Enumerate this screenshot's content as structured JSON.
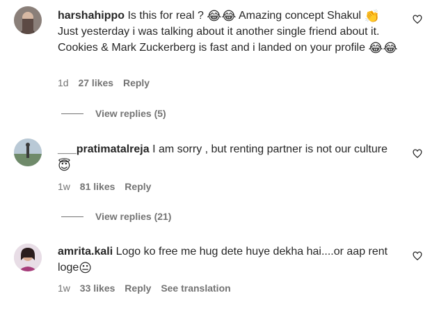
{
  "comments": [
    {
      "username": "harshahippo",
      "text_parts": [
        "Is this for real ? ",
        " Amazing concept Shakul ",
        " Just yesterday i was talking about it another single friend about it. Cookies & Mark Zuckerberg is fast and i landed on your profile "
      ],
      "emoji": [
        "😂😂",
        "👏",
        "😂😂"
      ],
      "time": "1d",
      "likes": "27 likes",
      "reply": "Reply",
      "view_replies": "View replies (5)"
    },
    {
      "username": "___pratimatalreja",
      "text_parts": [
        "I am sorry , but renting partner is not our culture "
      ],
      "emoji": [
        "😇"
      ],
      "time": "1w",
      "likes": "81 likes",
      "reply": "Reply",
      "view_replies": "View replies (21)"
    },
    {
      "username": "amrita.kali",
      "text_parts": [
        "Logo ko free me hug dete huye dekha hai....or aap rent loge"
      ],
      "emoji": [
        "😐"
      ],
      "time": "1w",
      "likes": "33 likes",
      "reply": "Reply",
      "see_translation": "See translation"
    }
  ],
  "icons": {
    "like": "heart-outline-icon"
  },
  "colors": {
    "text": "#262626",
    "secondary": "#737373",
    "background": "#ffffff"
  }
}
